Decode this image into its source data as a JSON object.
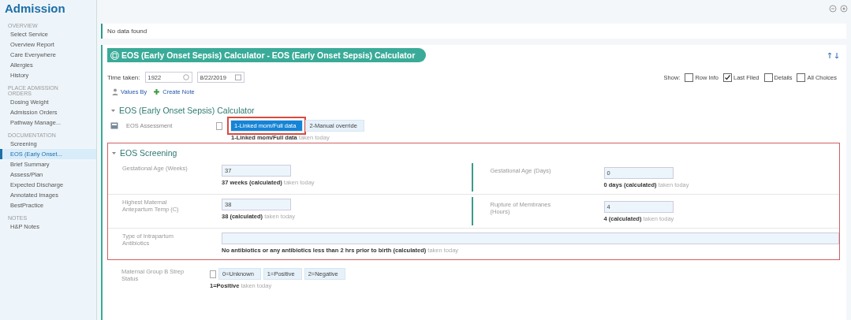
{
  "app_title": "Admission",
  "sidebar": {
    "groups": [
      {
        "heading": "OVERVIEW",
        "items": [
          {
            "label": "Select Service",
            "selected": false
          },
          {
            "label": "Overview Report",
            "selected": false
          },
          {
            "label": "Care Everywhere",
            "selected": false
          },
          {
            "label": "Allergies",
            "selected": false
          },
          {
            "label": "History",
            "selected": false
          }
        ]
      },
      {
        "heading": "PLACE ADMISSION ORDERS",
        "items": [
          {
            "label": "Dosing Weight",
            "selected": false
          },
          {
            "label": "Admission Orders",
            "selected": false
          },
          {
            "label": "Pathway Manage...",
            "selected": false
          }
        ]
      },
      {
        "heading": "DOCUMENTATION",
        "items": [
          {
            "label": "Screening",
            "selected": false
          },
          {
            "label": "EOS (Early Onset...",
            "selected": true
          },
          {
            "label": "Brief Summary",
            "selected": false
          },
          {
            "label": "Assess/Plan",
            "selected": false
          },
          {
            "label": "Expected Discharge",
            "selected": false
          },
          {
            "label": "Annotated Images",
            "selected": false
          },
          {
            "label": "BestPractice",
            "selected": false
          }
        ]
      },
      {
        "heading": "NOTES",
        "items": [
          {
            "label": "H&P Notes",
            "selected": false
          }
        ]
      }
    ]
  },
  "message": "No data found",
  "form_title": "EOS (Early Onset Sepsis) Calculator - EOS (Early Onset Sepsis) Calculator",
  "time_taken": {
    "label": "Time taken:",
    "time": "1922",
    "date": "8/22/2019"
  },
  "links": [
    "Values By",
    "Create Note"
  ],
  "show": {
    "label": "Show:",
    "options": [
      {
        "label": "Row Info",
        "checked": false
      },
      {
        "label": "Last Filed",
        "checked": true
      },
      {
        "label": "Details",
        "checked": false
      },
      {
        "label": "All Choices",
        "checked": false
      }
    ]
  },
  "calculator": {
    "title": "EOS (Early Onset Sepsis) Calculator",
    "expanded": true,
    "assessment": {
      "label": "EOS Assessment",
      "options": [
        {
          "label": "1-Linked mom/Full data",
          "selected": true
        },
        {
          "label": "2-Manual override",
          "selected": false
        }
      ],
      "result": "1-Linked mom/Full data",
      "taken": "taken today"
    }
  },
  "screening": {
    "title": "EOS Screening",
    "expanded": true,
    "rows": [
      [
        {
          "label": "Gestational Age (Weeks)",
          "value": "37",
          "result": "37 weeks (calculated)",
          "taken": "taken today"
        },
        {
          "label": "Gestational Age (Days)",
          "value": "0",
          "result": "0 days (calculated)",
          "taken": "taken today"
        }
      ],
      [
        {
          "label": "Highest Maternal Antepartum Temp (C)",
          "value": "38",
          "result": "38 (calculated)",
          "taken": "taken today"
        },
        {
          "label": "Rupture of Membranes (Hours)",
          "value": "4",
          "result": "4 (calculated)",
          "taken": "taken today"
        }
      ]
    ],
    "antibiotics": {
      "label": "Type of Intrapartum Antibiotics",
      "result": "No antibiotics or any antibiotics less than 2 hrs prior to birth (calculated)",
      "taken": "taken today"
    }
  },
  "group_b": {
    "label": "Maternal Group B Strep Status",
    "options": [
      {
        "label": "0=Unknown",
        "selected": false
      },
      {
        "label": "1=Positive",
        "selected": false
      },
      {
        "label": "2=Negative",
        "selected": false
      }
    ],
    "result": "1=Positive",
    "taken": "taken today"
  }
}
